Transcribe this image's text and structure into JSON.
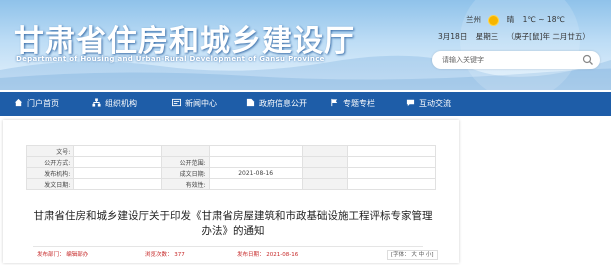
{
  "header": {
    "title": "甘肃省住房和城乡建设厅",
    "subtitle": "Department of Housing and Urban-Rural Development of Gansu Province",
    "weather": {
      "city": "兰州",
      "condition": "晴",
      "temp": "1℃ ~ 18℃",
      "icon": "sun-icon"
    },
    "date": {
      "day": "3月18日",
      "weekday": "星期三",
      "lunar": "（庚子[鼠]年 二月廿五）"
    },
    "search": {
      "placeholder": "请输入关键字",
      "icon": "search-icon"
    }
  },
  "nav": {
    "items": [
      {
        "label": "门户首页",
        "icon": "home-icon"
      },
      {
        "label": "组织机构",
        "icon": "org-icon"
      },
      {
        "label": "新闻中心",
        "icon": "news-icon"
      },
      {
        "label": "政府信息公开",
        "icon": "info-icon"
      },
      {
        "label": "专题专栏",
        "icon": "flag-icon"
      },
      {
        "label": "互动交流",
        "icon": "chat-icon"
      }
    ]
  },
  "document": {
    "meta": {
      "r1": {
        "l1": "文号:",
        "v1": "",
        "l2": "",
        "v2": "",
        "l3": "",
        "v3": ""
      },
      "r2": {
        "l1": "公开方式:",
        "v1": "",
        "l2": "公开范围:",
        "v2": "",
        "l3": "",
        "v3": ""
      },
      "r3": {
        "l1": "发布机构:",
        "v1": "",
        "l2": "成文日期:",
        "v2": "2021-08-16",
        "l3": "",
        "v3": ""
      },
      "r4": {
        "l1": "发文日期:",
        "v1": "",
        "l2": "有效性:",
        "v2": "",
        "l3": "",
        "v3": ""
      }
    },
    "title": "甘肃省住房和城乡建设厅关于印发《甘肃省房屋建筑和市政基础设施工程评标专家管理办法》的通知",
    "footer": {
      "dept": "发布部门：  编辑部办",
      "views": "浏览次数：  377",
      "date": "发布日期：  2021-08-16",
      "font_size": "[字体：  大  中  小]"
    }
  },
  "colors": {
    "nav_bg": "#1e5da8",
    "title_color": "#ffffff",
    "footer_text": "#c62828"
  }
}
